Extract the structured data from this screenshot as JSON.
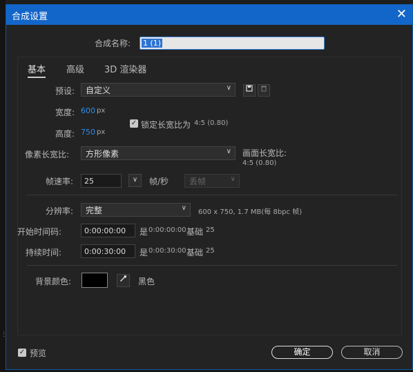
{
  "dialog": {
    "title": "合成设置",
    "close_glyph": "✕",
    "name_label": "合成名称:",
    "name_value": "1 (1)"
  },
  "tabs": [
    {
      "label": "基本",
      "active": true
    },
    {
      "label": "高级",
      "active": false
    },
    {
      "label": "3D 渲染器",
      "active": false
    }
  ],
  "preset": {
    "label": "预设:",
    "value": "自定义",
    "save_icon": "save-preset-icon",
    "delete_icon": "trash-icon"
  },
  "size": {
    "width_label": "宽度:",
    "width_value": "600",
    "width_unit": "px",
    "height_label": "高度:",
    "height_value": "750",
    "height_unit": "px",
    "lock_label": "锁定长宽比为",
    "lock_ratio": "4:5 (0.80)",
    "lock_checked": true
  },
  "pixel_aspect": {
    "label": "像素长宽比:",
    "value": "方形像素",
    "frame_aspect_label": "画面长宽比:",
    "frame_aspect_value": "4:5 (0.80)"
  },
  "frame_rate": {
    "label": "帧速率:",
    "value": "25",
    "unit": "帧/秒",
    "drop_frame_value": "丢帧"
  },
  "resolution": {
    "label": "分辨率:",
    "value": "完整",
    "info": "600 x 750, 1.7 MB(每 8bpc 帧)"
  },
  "start_timecode": {
    "label": "开始时间码:",
    "value": "0:00:00:00",
    "is_text": "是",
    "is_value": "0:00:00:00",
    "base_label": "基础",
    "base_value": "25"
  },
  "duration": {
    "label": "持续时间:",
    "value": "0:00:30:00",
    "is_text": "是",
    "is_value": "0:00:30:00",
    "base_label": "基础",
    "base_value": "25"
  },
  "background": {
    "label": "背景颜色:",
    "color": "#000000",
    "color_name": "黑色",
    "eyedropper_icon": "eyedropper-icon"
  },
  "footer": {
    "preview_label": "预览",
    "preview_checked": true,
    "ok_label": "确定",
    "cancel_label": "取消"
  },
  "colors": {
    "titlebar": "#1366c9",
    "accent_value": "#2d8ceb",
    "background": "#232323"
  }
}
